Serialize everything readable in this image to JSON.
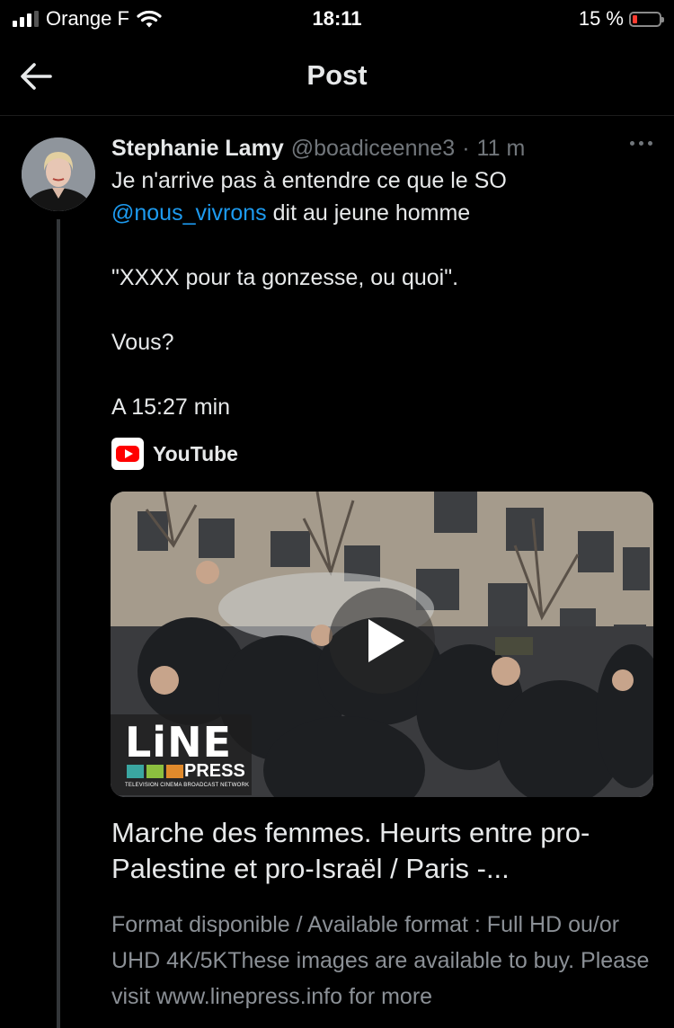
{
  "status_bar": {
    "carrier": "Orange F",
    "time": "18:11",
    "battery": "15 %",
    "battery_level_percent": 15,
    "icons": [
      "signal-icon",
      "wifi-icon",
      "battery-icon"
    ],
    "battery_color": "#ff3b30"
  },
  "nav": {
    "title": "Post",
    "back_icon": "arrow-left-icon"
  },
  "tweet": {
    "author_name": "Stephanie Lamy",
    "handle": "@boadiceenne3",
    "separator": "·",
    "time_ago": "11 m",
    "text_line1": "Je n'arrive pas à entendre ce que le SO",
    "mention": "@nous_vivrons",
    "text_line2_rest": " dit au jeune homme",
    "quote": "\"XXXX pour ta gonzesse, ou quoi\".",
    "question": "Vous?",
    "timestamp_note": "A 15:27 min",
    "mention_color": "#1d9bf0"
  },
  "link_card": {
    "source": "YouTube",
    "thumbnail_brand": "LiNE",
    "thumbnail_brand_sub": "PRESS",
    "thumbnail_tagline": "TELEVISION CINEMA BROADCAST NETWORK",
    "title": "Marche des femmes. Heurts entre pro-Palestine et pro-Israël / Paris -...",
    "description": "Format disponible / Available format : Full HD ou/or UHD 4K/5KThese images are available to buy. Please visit www.linepress.info for more"
  },
  "colors": {
    "background": "#000000",
    "text": "#e7e9ea",
    "muted": "#71767b",
    "youtube_red": "#ff0000"
  }
}
